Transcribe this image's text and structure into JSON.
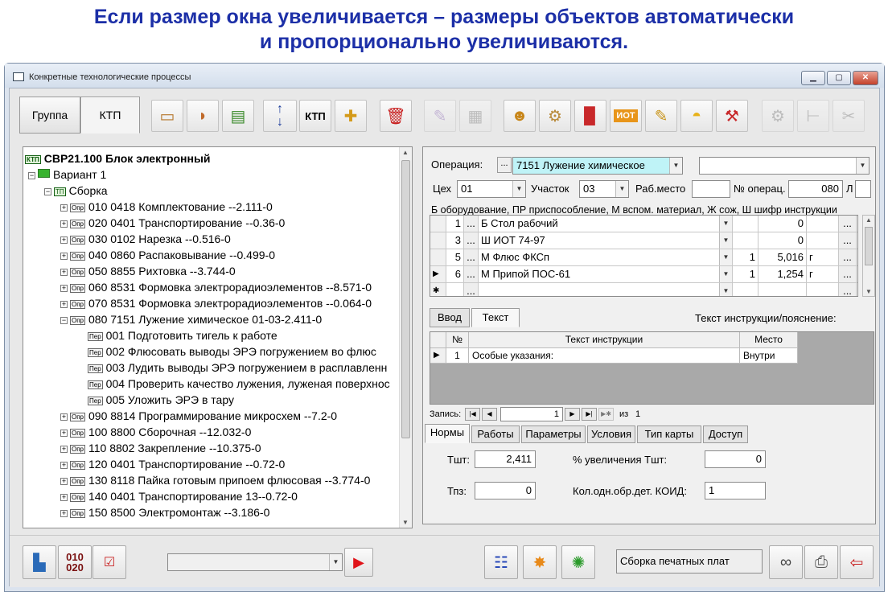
{
  "slide": {
    "title_line1": "Если размер окна увеличивается – размеры объектов автоматически",
    "title_line2": "и пропорционально увеличиваются."
  },
  "window": {
    "title": "Конкретные технологические процессы",
    "min": "▁",
    "max": "▢",
    "close": "✕"
  },
  "toolbar": {
    "tab_group": "Группа",
    "tab_ktp": "КТП",
    "ktp_button": "КТП",
    "move_up": "↑",
    "move_down": "↓"
  },
  "tree": {
    "root": "СВР21.100 Блок электронный",
    "variant": "Вариант 1",
    "assembly": "Сборка",
    "icon_ktp": "КТП",
    "icon_opr": "Опр",
    "icon_per": "Пер",
    "operations": [
      "010 0418 Комплектование --2.111-0",
      "020 0401 Транспортирование --0.36-0",
      "030 0102 Нарезка --0.516-0",
      "040 0860 Распаковывание --0.499-0",
      "050 8855 Рихтовка --3.744-0",
      "060 8531 Формовка электрорадиоэлементов --8.571-0",
      "070 8531 Формовка электрорадиоэлементов --0.064-0",
      "080 7151 Лужение химическое  01-03-2.411-0"
    ],
    "transitions": [
      "001 Подготовить тигель к работе",
      "002 Флюсовать выводы ЭРЭ погружением во флюс",
      "003 Лудить выводы ЭРЭ погружением в расплавленн",
      "004 Проверить качество лужения, луженая поверхнос",
      "005 Уложить ЭРЭ в тару"
    ],
    "operations_after": [
      "090 8814 Программирование микросхем --7.2-0",
      "100 8800 Сборочная --12.032-0",
      "110 8802 Закрепление --10.375-0",
      "120 0401 Транспортирование --0.72-0",
      "130 8118 Пайка готовым припоем флюсовая --3.774-0",
      "140 0401 Транспортирование  13--0.72-0",
      "150 8500 Электромонтаж --3.186-0"
    ]
  },
  "operation": {
    "label": "Операция:",
    "dots": "...",
    "value": "7151 Лужение химическое",
    "ceh_label": "Цех",
    "ceh_value": "01",
    "uchastok_label": "Участок",
    "uchastok_value": "03",
    "rabmesto_label": "Раб.место",
    "rabmesto_value": "",
    "nomer_label": "№ операц.",
    "nomer_value": "080",
    "l_label": "Л",
    "legend": "Б оборудование, ПР приспособление, М вспом. материал, Ж сож, Ш шифр инструкции"
  },
  "equipment": {
    "rows": [
      {
        "marker": "",
        "n": "1",
        "name": "Б Стол рабочий",
        "qty": "",
        "val": "0",
        "unit": ""
      },
      {
        "marker": "",
        "n": "3",
        "name": "Ш ИОТ 74-97",
        "qty": "",
        "val": "0",
        "unit": ""
      },
      {
        "marker": "",
        "n": "5",
        "name": "М Флюс ФКСп",
        "qty": "1",
        "val": "5,016",
        "unit": "г"
      },
      {
        "marker": "▶",
        "n": "6",
        "name": "М Припой ПОС-61",
        "qty": "1",
        "val": "1,254",
        "unit": "г"
      },
      {
        "marker": "✱",
        "n": "",
        "name": "",
        "qty": "",
        "val": "",
        "unit": ""
      }
    ]
  },
  "instr_tabs": {
    "input": "Ввод",
    "text": "Текст",
    "caption": "Текст инструкции/пояснение:"
  },
  "instructions": {
    "col_no": "№",
    "col_text": "Текст инструкции",
    "col_place": "Место",
    "rows": [
      {
        "marker": "▶",
        "no": "1",
        "text": "Особые указания:",
        "place": "Внутри"
      }
    ]
  },
  "record_nav": {
    "label": "Запись:",
    "current": "1",
    "of": "из",
    "total": "1"
  },
  "bottom_tabs": [
    "Нормы",
    "Работы",
    "Параметры",
    "Условия",
    "Тип карты",
    "Доступ"
  ],
  "norms": {
    "tsht_label": "Тшт:",
    "tsht_value": "2,411",
    "tpz_label": "Тпз:",
    "tpz_value": "0",
    "increase_label": "% увеличения Тшт:",
    "increase_value": "0",
    "koid_label": "Кол.одн.обр.дет. КОИД:",
    "koid_value": "1"
  },
  "bottom": {
    "code_button": "010\n020",
    "combo_value": "",
    "status_text": "Сборка печатных плат"
  },
  "colors": {
    "title_blue": "#1c2fa7",
    "highlight_cyan": "#bff3f7",
    "red_arrow": "#e0141a"
  }
}
